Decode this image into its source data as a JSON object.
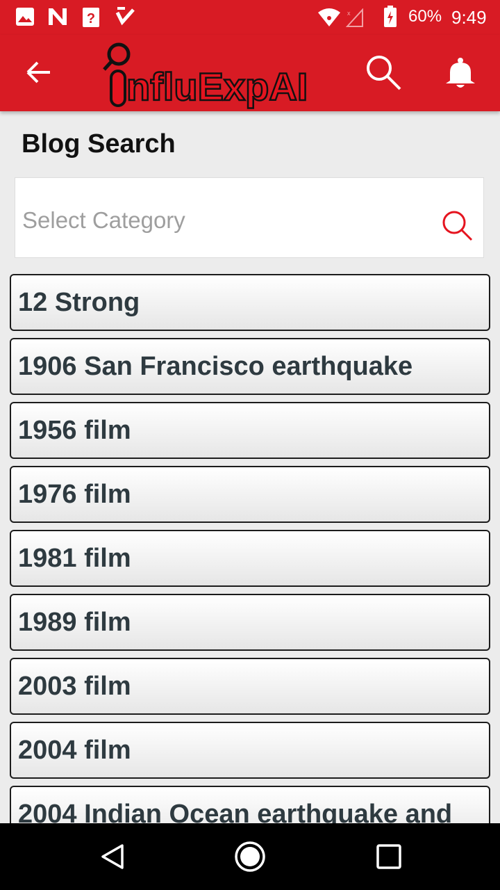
{
  "status_bar": {
    "battery": "60%",
    "time": "9:49",
    "notification_icons": [
      "image-icon",
      "n-app-icon",
      "help-icon",
      "check-icon"
    ],
    "system_icons": [
      "wifi-icon",
      "cell-signal-icon",
      "battery-charging-icon"
    ]
  },
  "app_bar": {
    "back_icon": "back-arrow-icon",
    "logo_text": "influExpAI",
    "search_icon": "search-icon",
    "notification_icon": "bell-icon"
  },
  "page": {
    "title": "Blog Search"
  },
  "search": {
    "placeholder": "Select Category",
    "value": ""
  },
  "categories": [
    "12 Strong",
    "1906 San Francisco earthquake",
    "1956 film",
    "1976 film",
    "1981 film",
    "1989 film",
    "2003 film",
    "2004 film",
    "2004 Indian Ocean earthquake and"
  ],
  "nav_bar": {
    "icons": [
      "back-triangle-icon",
      "home-circle-icon",
      "recents-square-icon"
    ]
  },
  "colors": {
    "brand_red": "#d81b24",
    "list_text": "#2e3a40",
    "background": "#ececec"
  }
}
